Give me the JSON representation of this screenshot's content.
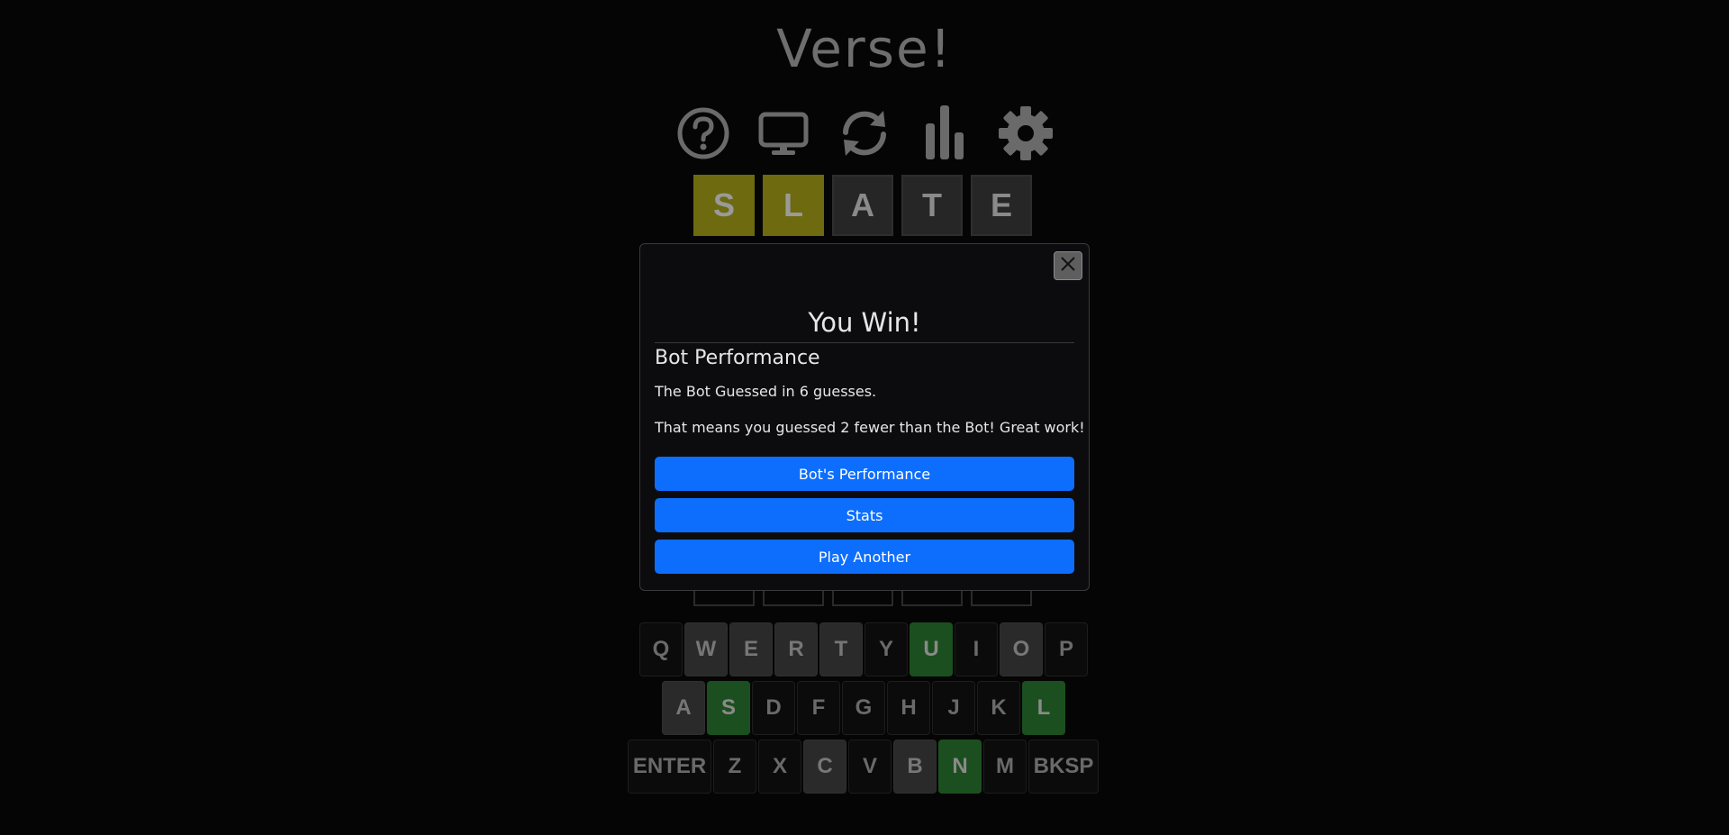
{
  "app": {
    "title": "Verse!"
  },
  "toolbar": {
    "icons": [
      "help-icon",
      "monitor-icon",
      "refresh-icon",
      "stats-icon",
      "settings-icon"
    ]
  },
  "board": {
    "rows": [
      [
        {
          "letter": "S",
          "state": "present"
        },
        {
          "letter": "L",
          "state": "present"
        },
        {
          "letter": "A",
          "state": "absent"
        },
        {
          "letter": "T",
          "state": "absent"
        },
        {
          "letter": "E",
          "state": "absent"
        }
      ],
      [
        {
          "letter": "",
          "state": "empty"
        },
        {
          "letter": "",
          "state": "empty"
        },
        {
          "letter": "",
          "state": "empty"
        },
        {
          "letter": "",
          "state": "empty"
        },
        {
          "letter": "",
          "state": "empty"
        }
      ]
    ]
  },
  "keyboard": {
    "rows": [
      [
        {
          "key": "Q",
          "state": "unused"
        },
        {
          "key": "W",
          "state": "absent"
        },
        {
          "key": "E",
          "state": "absent"
        },
        {
          "key": "R",
          "state": "absent"
        },
        {
          "key": "T",
          "state": "absent"
        },
        {
          "key": "Y",
          "state": "unused"
        },
        {
          "key": "U",
          "state": "correct"
        },
        {
          "key": "I",
          "state": "unused"
        },
        {
          "key": "O",
          "state": "absent"
        },
        {
          "key": "P",
          "state": "unused"
        }
      ],
      [
        {
          "key": "A",
          "state": "absent"
        },
        {
          "key": "S",
          "state": "correct"
        },
        {
          "key": "D",
          "state": "unused"
        },
        {
          "key": "F",
          "state": "unused"
        },
        {
          "key": "G",
          "state": "unused"
        },
        {
          "key": "H",
          "state": "unused"
        },
        {
          "key": "J",
          "state": "unused"
        },
        {
          "key": "K",
          "state": "unused"
        },
        {
          "key": "L",
          "state": "correct"
        }
      ],
      [
        {
          "key": "ENTER",
          "state": "unused"
        },
        {
          "key": "Z",
          "state": "unused"
        },
        {
          "key": "X",
          "state": "unused"
        },
        {
          "key": "C",
          "state": "absent"
        },
        {
          "key": "V",
          "state": "unused"
        },
        {
          "key": "B",
          "state": "absent"
        },
        {
          "key": "N",
          "state": "correct"
        },
        {
          "key": "M",
          "state": "unused"
        },
        {
          "key": "BKSP",
          "state": "unused"
        }
      ]
    ]
  },
  "modal": {
    "title": "You Win!",
    "subtitle": "Bot Performance",
    "bot_guesses_text": "The Bot Guessed in 6 guesses.",
    "result_text": "That means you guessed 2 fewer than the Bot! Great work!",
    "buttons": {
      "bot_performance": "Bot's Performance",
      "stats": "Stats",
      "play_another": "Play Another"
    },
    "close_icon": "close-icon"
  },
  "colors": {
    "present": "#6d6a10",
    "correct": "#1c4f1f",
    "absent": "#2a2a2a",
    "primary": "#0d6efd"
  }
}
